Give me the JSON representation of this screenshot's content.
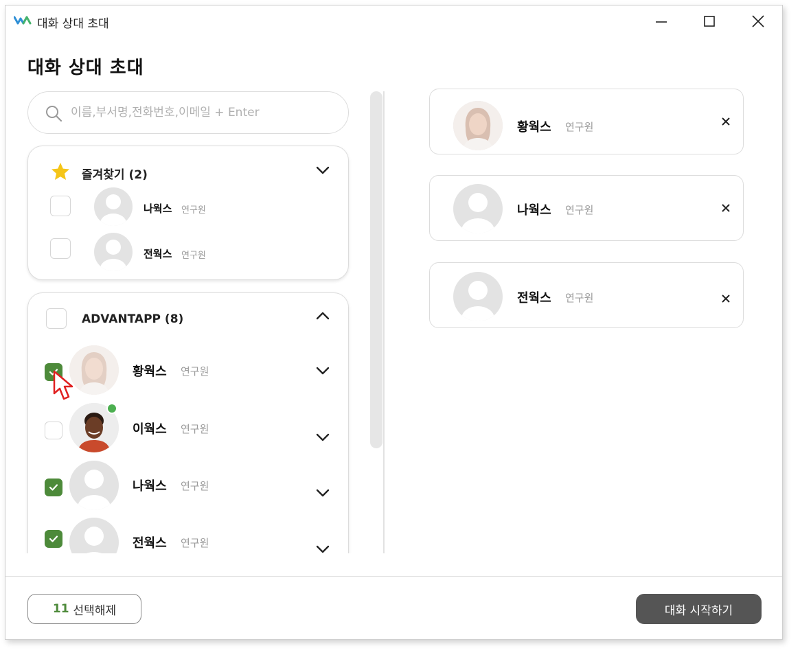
{
  "window": {
    "title": "대화 상대 초대"
  },
  "page": {
    "heading": "대화 상대 초대"
  },
  "search": {
    "placeholder": "이름,부서명,전화번호,이메일 + Enter",
    "value": ""
  },
  "favorites": {
    "title": "즐겨찾기 (2)",
    "expanded": true,
    "members": [
      {
        "name": "나웍스",
        "role": "연구원",
        "checked": false
      },
      {
        "name": "전웍스",
        "role": "연구원",
        "checked": false
      }
    ]
  },
  "advantapp": {
    "title": "ADVANTAPP (8)",
    "checked": false,
    "expanded": true,
    "members": [
      {
        "name": "황웍스",
        "role": "연구원",
        "checked": true,
        "avatar": "photo-woman"
      },
      {
        "name": "이웍스",
        "role": "연구원",
        "checked": false,
        "avatar": "photo-man",
        "status": "online"
      },
      {
        "name": "나웍스",
        "role": "연구원",
        "checked": true,
        "avatar": "placeholder"
      },
      {
        "name": "전웍스",
        "role": "연구원",
        "checked": true,
        "avatar": "placeholder"
      }
    ]
  },
  "selected": [
    {
      "name": "황웍스",
      "role": "연구원",
      "avatar": "photo-woman"
    },
    {
      "name": "나웍스",
      "role": "연구원",
      "avatar": "placeholder"
    },
    {
      "name": "전웍스",
      "role": "연구원",
      "avatar": "placeholder"
    }
  ],
  "footer": {
    "deselect_count": "11",
    "deselect_label": "선택해제",
    "start_label": "대화 시작하기"
  },
  "colors": {
    "accent_green": "#4d8a3a",
    "online": "#4caf50",
    "star": "#f5c518",
    "primary_button": "#555555"
  },
  "icons": {
    "app": "app-logo-icon",
    "search": "search-icon",
    "star": "star-icon",
    "chevron_up": "chevron-up-icon",
    "chevron_down": "chevron-down-icon",
    "remove": "close-icon",
    "check": "check-icon"
  }
}
